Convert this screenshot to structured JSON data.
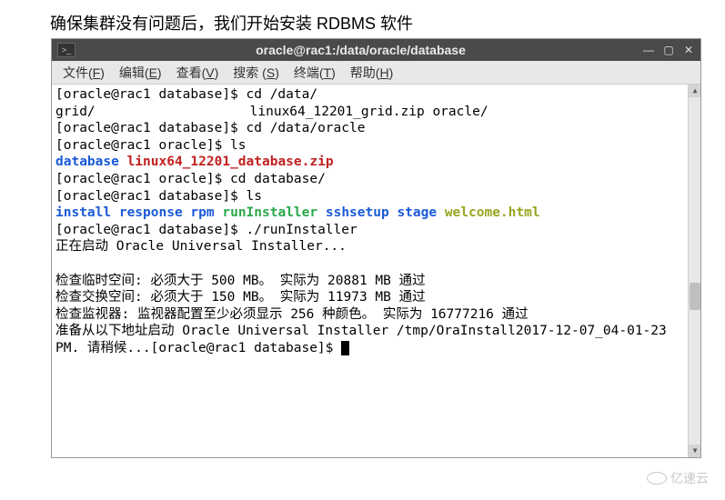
{
  "intro": "确保集群没有问题后，我们开始安装 RDBMS 软件",
  "titlebar": {
    "title": "oracle@rac1:/data/oracle/database"
  },
  "window_controls": {
    "minimize": "—",
    "maximize": "▢",
    "close": "✕"
  },
  "menubar": {
    "file": "文件",
    "file_u": "F",
    "edit": "编辑",
    "edit_u": "E",
    "view": "查看",
    "view_u": "V",
    "search": "搜索",
    "search_u": "S",
    "terminal": "终端",
    "terminal_u": "T",
    "help": "帮助",
    "help_u": "H"
  },
  "terminal": {
    "l1": "[oracle@rac1 database]$ cd /data/",
    "l2a": "grid/",
    "l2b": "linux64_12201_grid.zip  oracle/",
    "l3": "[oracle@rac1 database]$ cd /data/oracle",
    "l4": "[oracle@rac1 oracle]$ ls",
    "l5a": "database",
    "l5b": "linux64_12201_database.zip",
    "l6": "[oracle@rac1 oracle]$ cd database/",
    "l7": "[oracle@rac1 database]$ ls",
    "l8a": "install",
    "l8b": "response",
    "l8c": "rpm",
    "l8d": "runInstaller",
    "l8e": "sshsetup",
    "l8f": "stage",
    "l8g": "welcome.html",
    "l9": "[oracle@rac1 database]$ ./runInstaller",
    "l10": "正在启动 Oracle Universal Installer...",
    "l11": "检查临时空间: 必须大于 500 MB。   实际为 20881 MB    通过",
    "l12": "检查交换空间: 必须大于 150 MB。   实际为 11973 MB    通过",
    "l13": "检查监视器: 监视器配置至少必须显示 256 种颜色。    实际为 16777216    通过",
    "l14": "准备从以下地址启动 Oracle Universal Installer /tmp/OraInstall2017-12-07_04-01-23",
    "l15": "PM. 请稍候...[oracle@rac1 database]$ "
  },
  "watermark": {
    "text": "亿速云"
  }
}
